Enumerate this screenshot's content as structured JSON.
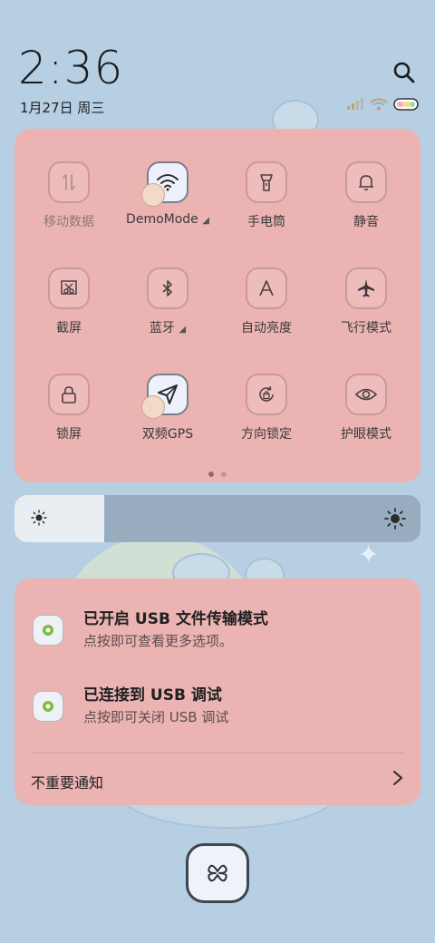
{
  "header": {
    "time": "2:36",
    "date": "1月27日 周三"
  },
  "icons": {
    "search": "search-icon",
    "signal": "signal-icon",
    "wifi": "wifi-icon",
    "battery": "battery-icon"
  },
  "quick_settings": {
    "tiles": [
      {
        "label": "移动数据",
        "icon": "mobile-data-icon",
        "active": false,
        "dim": true
      },
      {
        "label": "DemoMode",
        "icon": "wifi-icon",
        "active": true,
        "expandable": true
      },
      {
        "label": "手电筒",
        "icon": "flashlight-icon",
        "active": false
      },
      {
        "label": "静音",
        "icon": "bell-icon",
        "active": false
      },
      {
        "label": "截屏",
        "icon": "screenshot-icon",
        "active": false
      },
      {
        "label": "蓝牙",
        "icon": "bluetooth-icon",
        "active": false,
        "expandable": true
      },
      {
        "label": "自动亮度",
        "icon": "auto-brightness-icon",
        "active": false
      },
      {
        "label": "飞行模式",
        "icon": "airplane-icon",
        "active": false
      },
      {
        "label": "锁屏",
        "icon": "lock-icon",
        "active": false
      },
      {
        "label": "双频GPS",
        "icon": "location-arrow-icon",
        "active": true
      },
      {
        "label": "方向锁定",
        "icon": "rotation-lock-icon",
        "active": false
      },
      {
        "label": "护眼模式",
        "icon": "eye-icon",
        "active": false
      }
    ],
    "pages": 2,
    "current_page": 1
  },
  "brightness": {
    "level": 0.22
  },
  "notifications": {
    "items": [
      {
        "title": "已开启 USB 文件传输模式",
        "subtitle": "点按即可查看更多选项。"
      },
      {
        "title": "已连接到 USB 调试",
        "subtitle": "点按即可关闭 USB 调试"
      }
    ],
    "unimportant_label": "不重要通知"
  },
  "colors": {
    "panel": "#ecb3b3",
    "background": "#b6cfe3",
    "active_tile": "#eef1fb"
  }
}
